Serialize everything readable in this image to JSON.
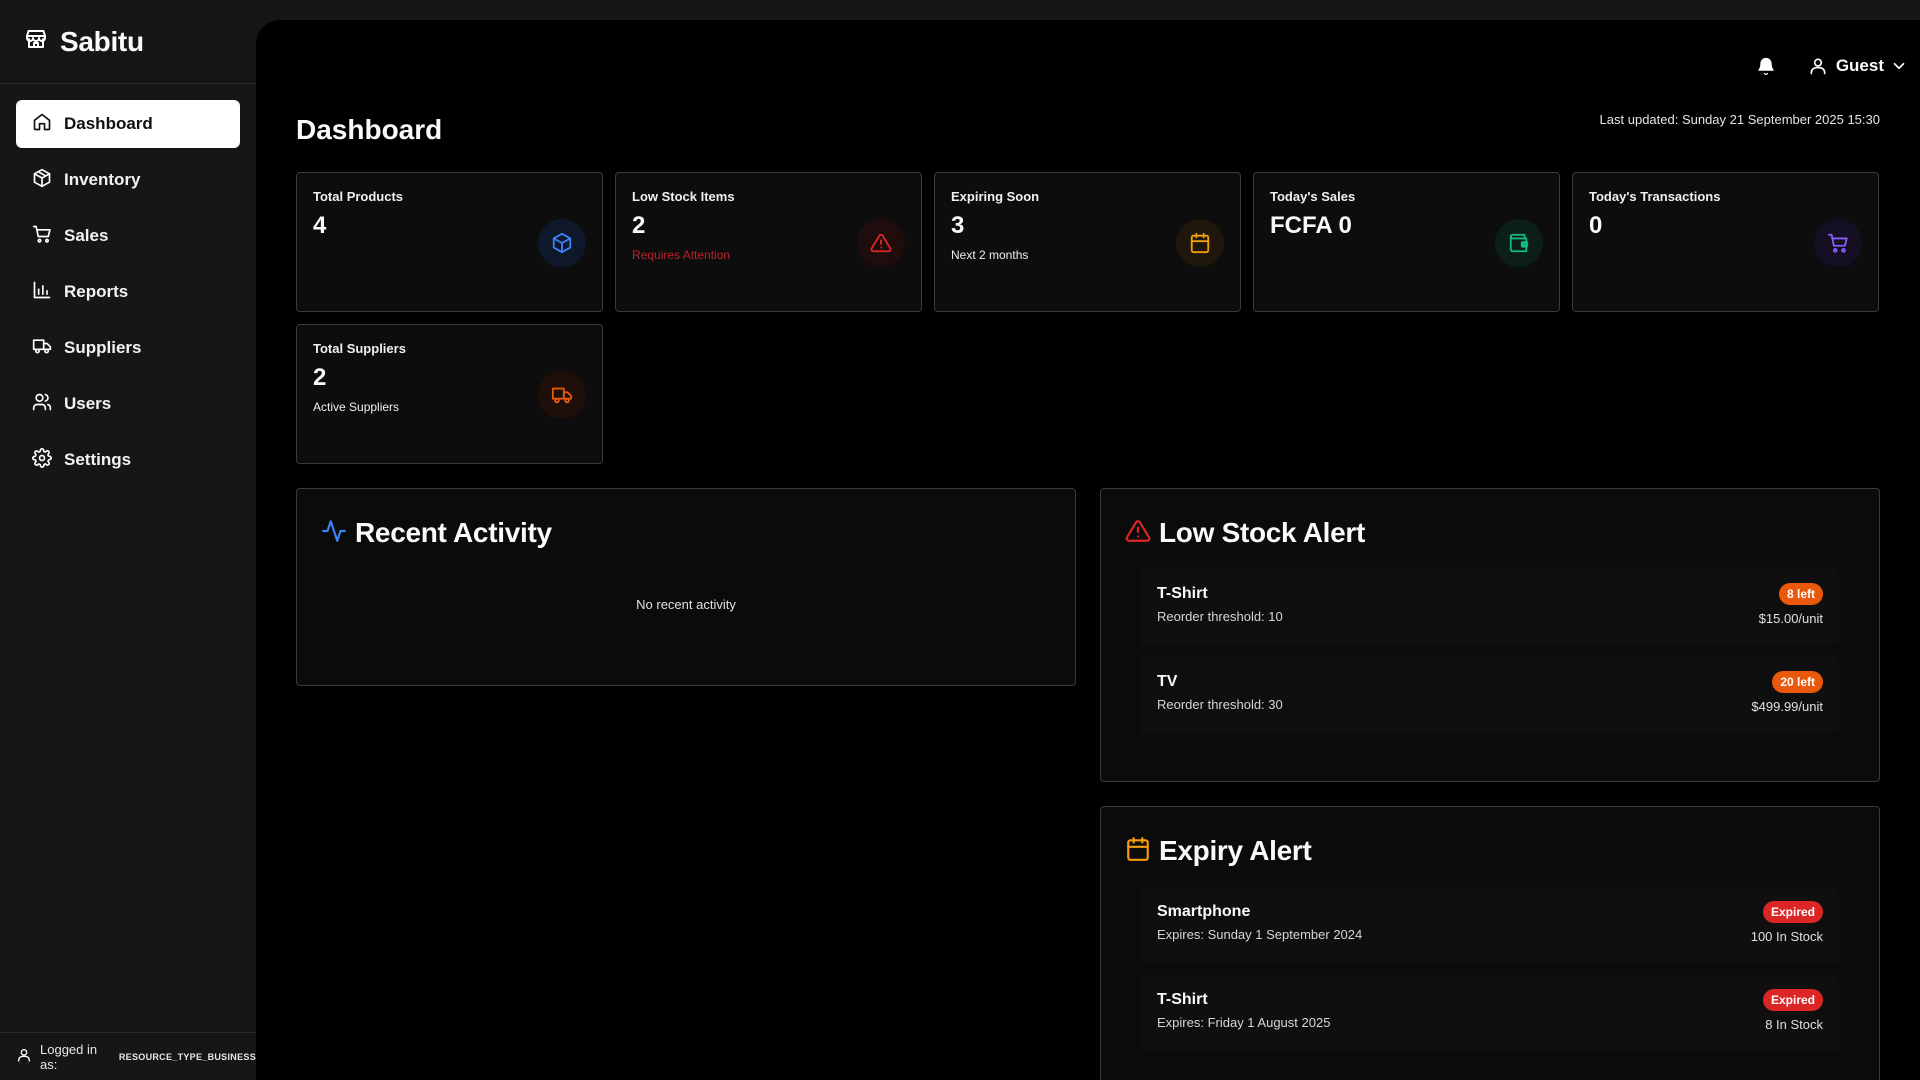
{
  "brand": {
    "name": "Sabitu"
  },
  "sidebar": {
    "items": [
      {
        "label": "Dashboard",
        "icon": "home-icon",
        "active": true
      },
      {
        "label": "Inventory",
        "icon": "package-icon"
      },
      {
        "label": "Sales",
        "icon": "cart-icon"
      },
      {
        "label": "Reports",
        "icon": "bar-chart-icon"
      },
      {
        "label": "Suppliers",
        "icon": "truck-icon"
      },
      {
        "label": "Users",
        "icon": "users-icon"
      },
      {
        "label": "Settings",
        "icon": "gear-icon"
      }
    ],
    "footer": {
      "label": "Logged in as:",
      "value": "RESOURCE_TYPE_BUSINESS"
    }
  },
  "header": {
    "user_name": "Guest"
  },
  "page": {
    "title": "Dashboard",
    "last_updated": "Last updated: Sunday 21 September 2025 15:30"
  },
  "stats": [
    {
      "title": "Total Products",
      "value": "4",
      "sub": "",
      "icon": "box-icon",
      "color": "#3b82f6",
      "bg": "#0f172a"
    },
    {
      "title": "Low Stock Items",
      "value": "2",
      "sub": "Requires Attention",
      "icon": "alert-triangle-icon",
      "color": "#dc2626",
      "bg": "#1f0d0d"
    },
    {
      "title": "Expiring Soon",
      "value": "3",
      "sub": "Next 2 months",
      "icon": "calendar-icon",
      "color": "#f59e0b",
      "bg": "#1f170b"
    },
    {
      "title": "Today's Sales",
      "value": "FCFA 0",
      "sub": "",
      "icon": "wallet-icon",
      "color": "#10b981",
      "bg": "#0b1f17"
    },
    {
      "title": "Today's Transactions",
      "value": "0",
      "sub": "",
      "icon": "cart-icon",
      "color": "#8b5cf6",
      "bg": "#150f24"
    },
    {
      "title": "Total Suppliers",
      "value": "2",
      "sub": "Active Suppliers",
      "icon": "truck-icon",
      "color": "#ea580c",
      "bg": "#1f0f0b"
    }
  ],
  "recent_activity": {
    "title": "Recent Activity",
    "empty": "No recent activity"
  },
  "low_stock": {
    "title": "Low Stock Alert",
    "items": [
      {
        "name": "T-Shirt",
        "detail": "Reorder threshold: 10",
        "badge": "8 left",
        "price": "$15.00/unit"
      },
      {
        "name": "TV",
        "detail": "Reorder threshold: 30",
        "badge": "20 left",
        "price": "$499.99/unit"
      }
    ]
  },
  "expiry": {
    "title": "Expiry Alert",
    "items": [
      {
        "name": "Smartphone",
        "detail": "Expires: Sunday 1 September 2024",
        "badge": "Expired",
        "stock": "100 In Stock"
      },
      {
        "name": "T-Shirt",
        "detail": "Expires: Friday 1 August 2025",
        "badge": "Expired",
        "stock": "8 In Stock"
      }
    ]
  }
}
